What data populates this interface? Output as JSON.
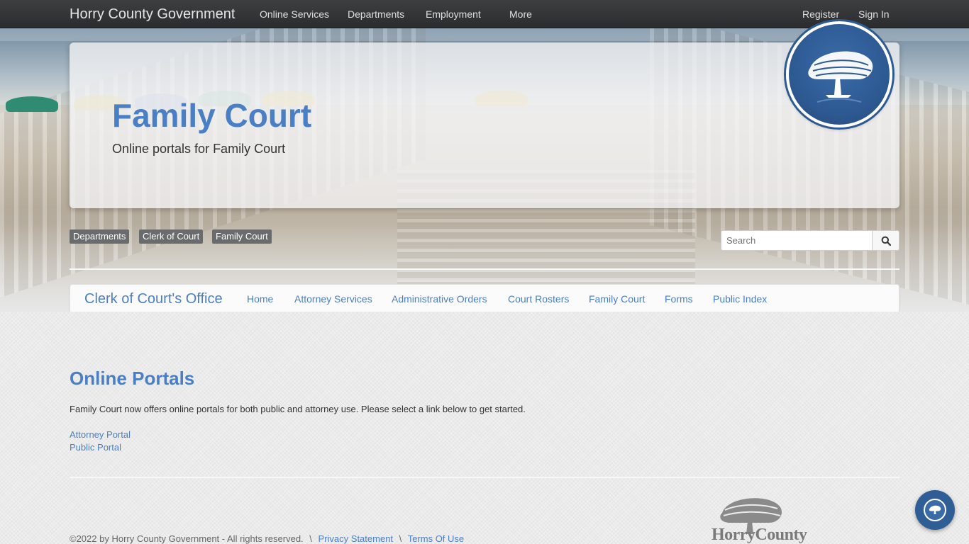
{
  "topnav": {
    "brand": "Horry County Government",
    "links": [
      "Online Services",
      "Departments",
      "Employment",
      "More"
    ],
    "register": "Register",
    "signin": "Sign In"
  },
  "hero": {
    "title": "Family Court",
    "subtitle": "Online portals for Family Court"
  },
  "breadcrumb": [
    "Departments",
    "Clerk of Court",
    "Family Court"
  ],
  "search": {
    "placeholder": "Search"
  },
  "subnav": {
    "title": "Clerk of Court's Office",
    "links": [
      "Home",
      "Attorney Services",
      "Administrative Orders",
      "Court Rosters",
      "Family Court",
      "Forms",
      "Public Index"
    ]
  },
  "content": {
    "title": "Online Portals",
    "paragraph": "Family Court now offers online portals for both public and attorney use. Please select a link below to get started.",
    "links": [
      "Attorney Portal",
      "Public Portal"
    ]
  },
  "footer": {
    "copyright": "©2022 by Horry County Government - All rights reserved.",
    "privacy": "Privacy Statement",
    "terms": "Terms Of Use",
    "separator": "\\",
    "logo_text": "HorryCounty"
  },
  "colors": {
    "accent": "#4a7fc6",
    "seal_blue": "#2e5a93",
    "topnav_bg": "#2b2c2e"
  },
  "icons": {
    "search_button": "search-icon",
    "seal": "tree-icon",
    "chat": "tree-icon"
  }
}
